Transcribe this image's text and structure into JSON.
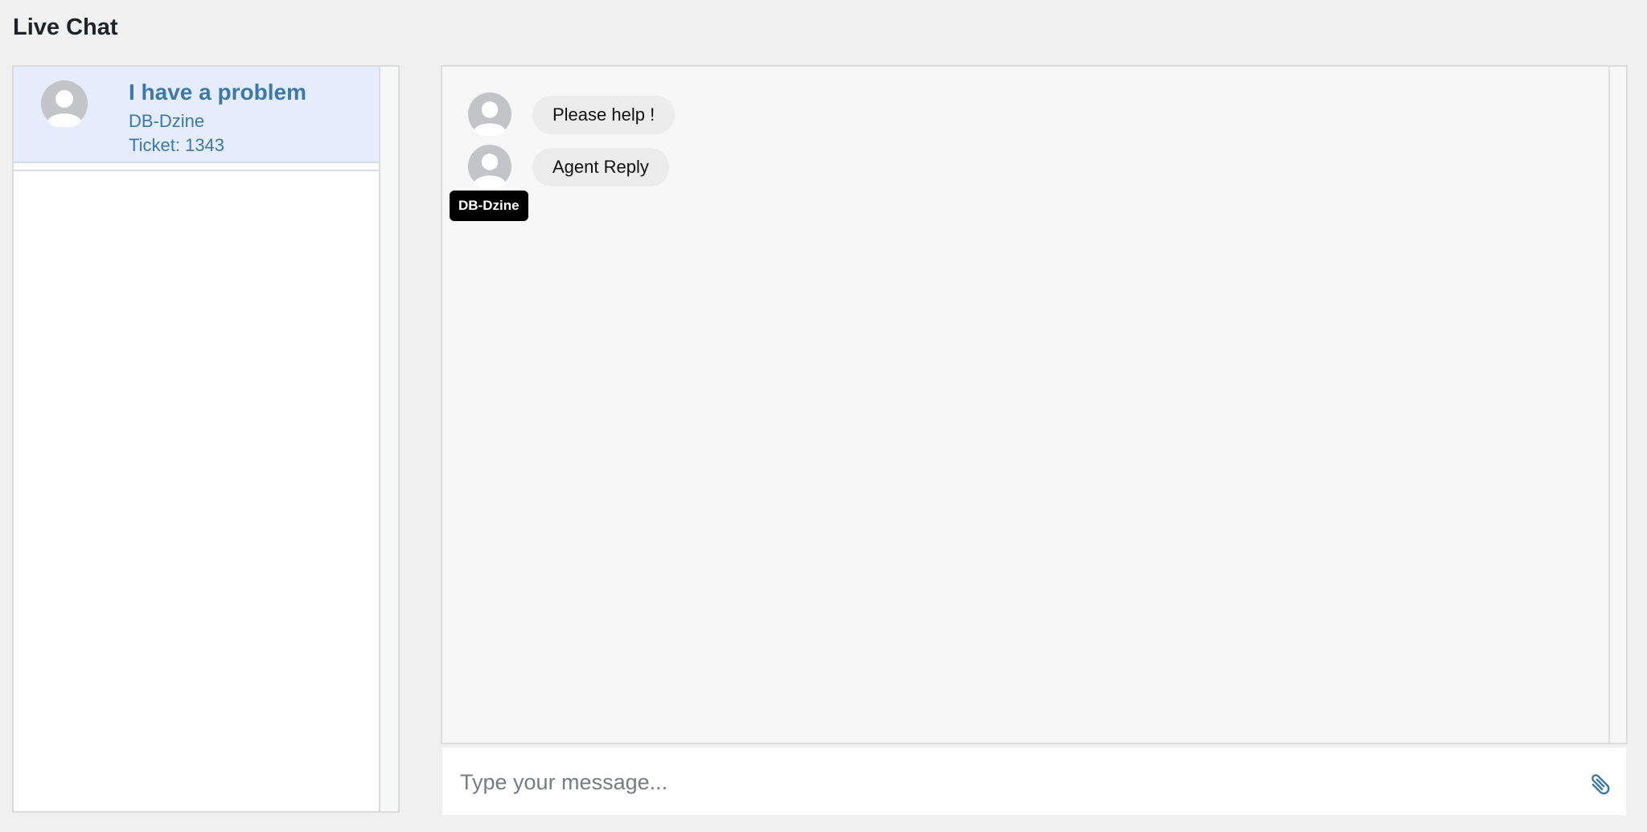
{
  "page": {
    "title": "Live Chat"
  },
  "tickets": [
    {
      "title": "I have a problem",
      "user": "DB-Dzine",
      "ticket": "Ticket: 1343",
      "selected": true
    }
  ],
  "chat": {
    "messages": [
      {
        "text": "Please help !",
        "avatar": "default-avatar-icon"
      },
      {
        "text": "Agent Reply",
        "avatar": "default-avatar-icon"
      }
    ],
    "tooltip": "DB-Dzine"
  },
  "composer": {
    "placeholder": "Type your message...",
    "attach_icon": "paperclip-icon"
  },
  "colors": {
    "accent": "#3c78a8",
    "selected_bg": "#e5edfc",
    "bubble_bg": "#ececec",
    "tooltip_bg": "#000000"
  }
}
